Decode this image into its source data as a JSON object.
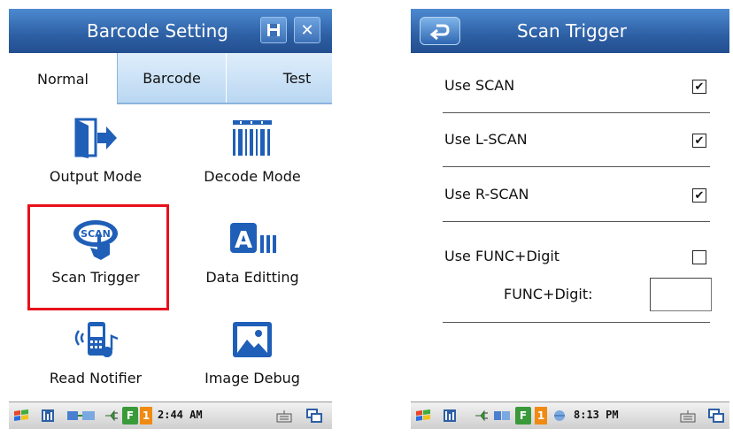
{
  "left": {
    "title": "Barcode Setting",
    "tabs": [
      "Normal",
      "Barcode",
      "Test"
    ],
    "items": [
      {
        "label": "Output Mode",
        "icon": "output-mode-icon"
      },
      {
        "label": "Decode Mode",
        "icon": "barcode-icon"
      },
      {
        "label": "Scan Trigger",
        "icon": "scan-trigger-icon"
      },
      {
        "label": "Data Editting",
        "icon": "data-editing-icon"
      },
      {
        "label": "Read Notifier",
        "icon": "read-notifier-icon"
      },
      {
        "label": "Image Debug",
        "icon": "image-icon"
      }
    ],
    "icon_scan_text": "SCAN",
    "icon_data_text": "A",
    "taskbar": {
      "clock": "2:44 AM",
      "f_label": "F",
      "one_label": "1"
    }
  },
  "right": {
    "title": "Scan Trigger",
    "options": [
      {
        "label": "Use SCAN",
        "checked": true
      },
      {
        "label": "Use L-SCAN",
        "checked": true
      },
      {
        "label": "Use R-SCAN",
        "checked": true
      },
      {
        "label": "Use FUNC+Digit",
        "checked": false
      }
    ],
    "func_digit_label": "FUNC+Digit:",
    "taskbar": {
      "clock": "8:13 PM",
      "f_label": "F",
      "one_label": "1"
    }
  },
  "colors": {
    "title_bar": "#2d5fa4",
    "highlight": "#e8101a",
    "icon_blue": "#1f5fb8"
  }
}
